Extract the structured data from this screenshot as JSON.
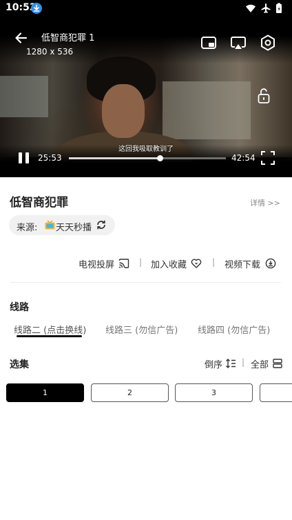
{
  "status_bar": {
    "time": "10:53",
    "icons": [
      "download-badge-icon",
      "wifi-icon",
      "airplane-icon",
      "battery-icon"
    ]
  },
  "player": {
    "title": "低智商犯罪 1",
    "resolution": "1280 x 536",
    "subtitle": "这回我吸取教训了",
    "current_time": "25:53",
    "total_time": "42:54",
    "progress": 0.58,
    "controls": [
      "back-arrow-icon",
      "pip-icon",
      "cast-icon",
      "settings-icon",
      "lock-icon",
      "pause-icon",
      "fullscreen-icon"
    ]
  },
  "details": {
    "title": "低智商犯罪",
    "details_link": "详情 >>",
    "source_label": "来源:",
    "source_name": "天天秒播",
    "actions": {
      "cast": "电视投屏",
      "favorite": "加入收藏",
      "download": "视频下载",
      "separator": "|"
    }
  },
  "routes": {
    "heading": "线路",
    "items": [
      "线路二 (点击换线)",
      "线路三 (勿信广告)",
      "线路四 (勿信广告)"
    ],
    "selected_index": 0
  },
  "episodes": {
    "heading": "选集",
    "order_label": "倒序",
    "all_label": "全部",
    "separator": "|",
    "items": [
      "1",
      "2",
      "3",
      ""
    ],
    "selected_index": 0
  },
  "colors": {
    "accent": "#000000",
    "muted_text": "#777777",
    "pill_bg": "#f1f1f1",
    "download_badge": "#2f8ff0"
  }
}
